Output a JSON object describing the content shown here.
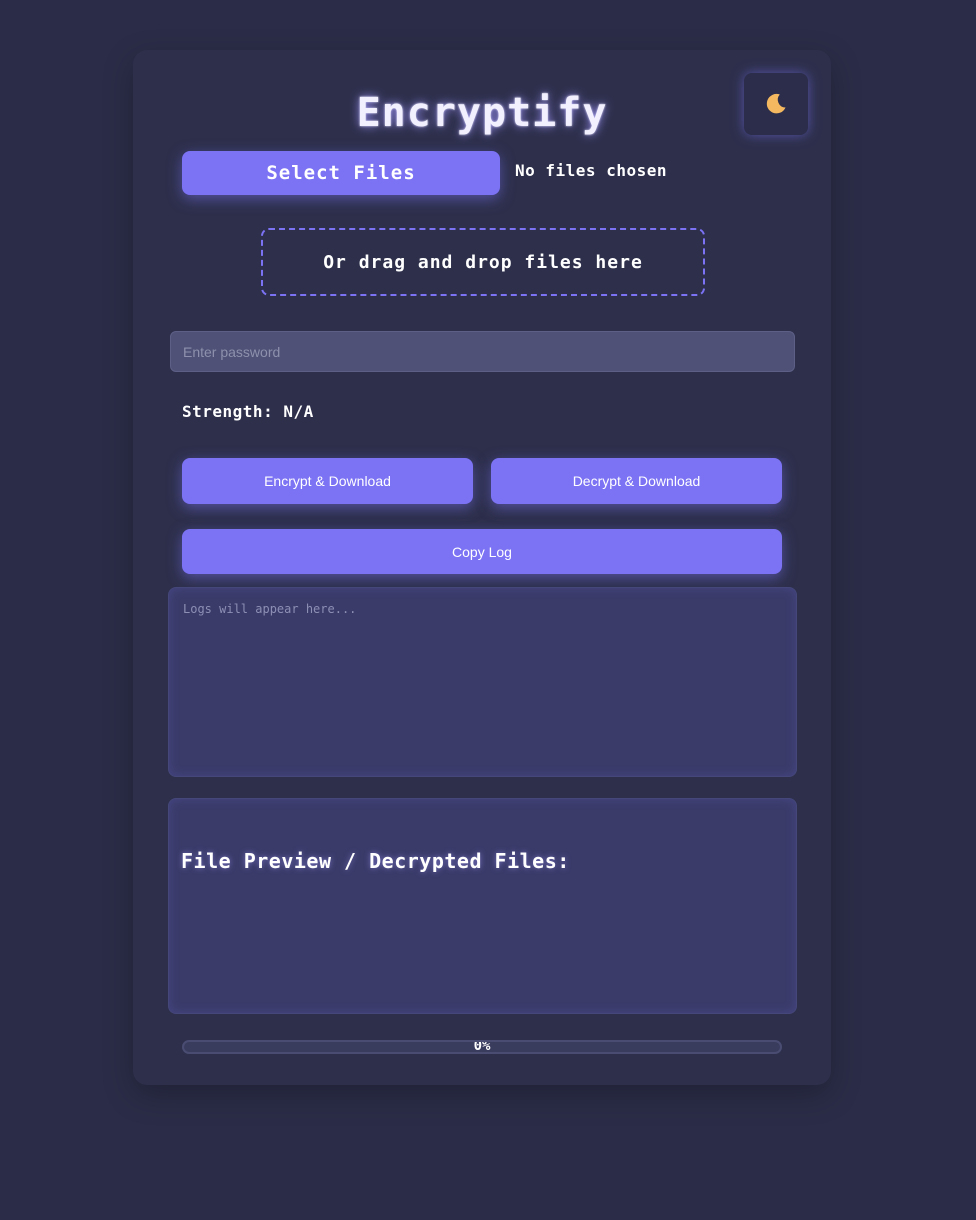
{
  "app": {
    "title": "Encryptify"
  },
  "theme_toggle": {
    "icon": "moon-icon"
  },
  "file_select": {
    "button_label": "Select Files",
    "status": "No files chosen"
  },
  "dropzone": {
    "label": "Or drag and drop files here"
  },
  "password": {
    "value": "",
    "placeholder": "Enter password"
  },
  "strength": {
    "text": "Strength: N/A"
  },
  "actions": {
    "encrypt_label": "Encrypt & Download",
    "decrypt_label": "Decrypt & Download",
    "copy_log_label": "Copy Log"
  },
  "log": {
    "placeholder": "Logs will appear here..."
  },
  "preview": {
    "heading": "File Preview / Decrypted Files:"
  },
  "progress": {
    "value": 0,
    "label": "0%"
  },
  "colors": {
    "accent": "#7b72f4",
    "background": "#2b2d48",
    "panel": "#3a3b69"
  }
}
